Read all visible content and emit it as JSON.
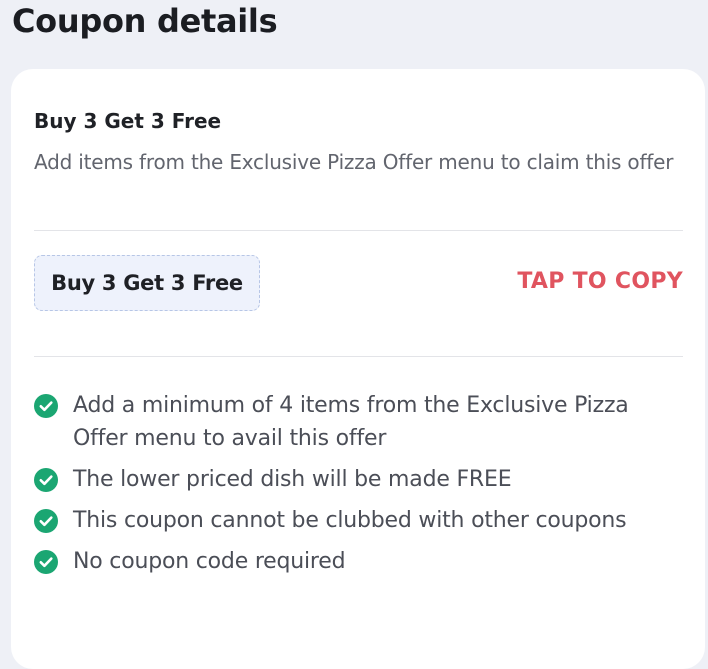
{
  "page": {
    "title": "Coupon details"
  },
  "offer": {
    "title": "Buy 3 Get 3 Free",
    "description": "Add items from the Exclusive Pizza Offer menu to claim this offer"
  },
  "coupon": {
    "code": "Buy 3 Get 3 Free",
    "copy_label": "TAP TO COPY"
  },
  "terms": [
    {
      "text": "Add a minimum of 4 items from the Exclusive Pizza Offer menu to avail this offer",
      "icon": "check-circle-icon"
    },
    {
      "text": "The lower priced dish will be made FREE",
      "icon": "check-circle-icon"
    },
    {
      "text": "This coupon cannot be clubbed with other coupons",
      "icon": "check-circle-icon"
    },
    {
      "text": "No coupon code required",
      "icon": "check-circle-icon"
    }
  ],
  "colors": {
    "background": "#eef0f6",
    "card": "#ffffff",
    "accent_copy": "#e0545f",
    "check_green": "#1ba672",
    "code_box_bg": "#eef2fc",
    "code_box_border": "#b7c6e6"
  }
}
